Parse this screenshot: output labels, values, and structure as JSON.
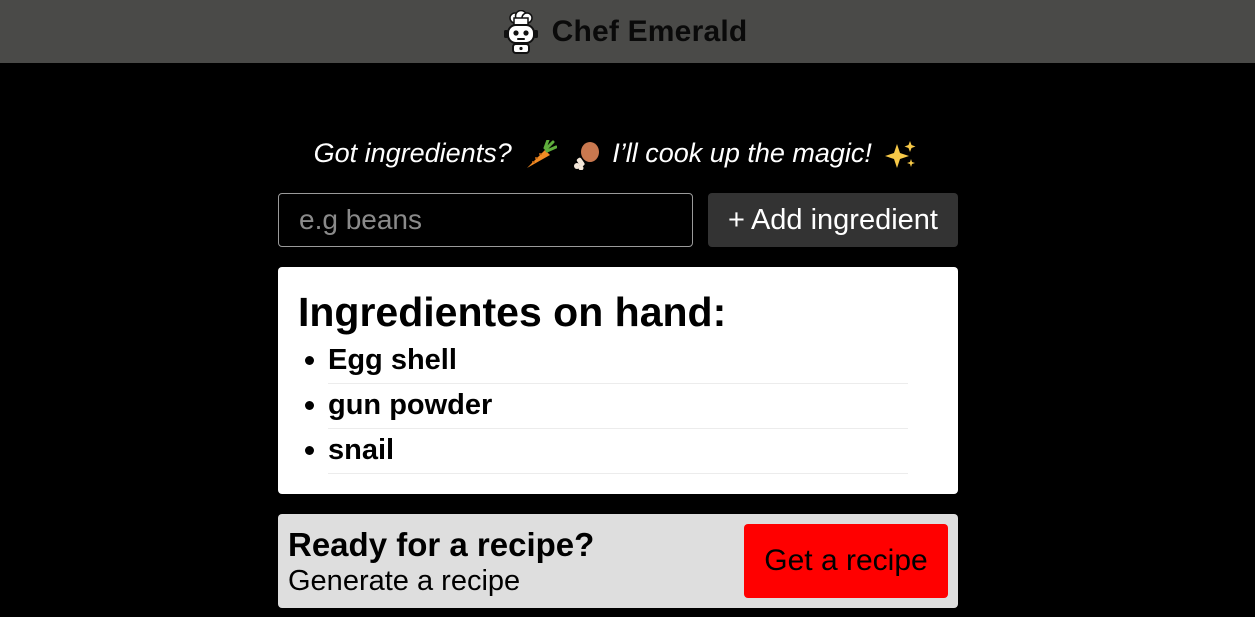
{
  "header": {
    "title": "Chef Emerald",
    "icon": "chef-robot-icon"
  },
  "tagline": {
    "text_start": "Got ingredients?",
    "text_end": "I’ll cook up the magic!",
    "icons": [
      "carrot-icon",
      "drumstick-icon",
      "sparkles-icon"
    ]
  },
  "form": {
    "placeholder": "e.g beans",
    "value": "",
    "add_label": "Add ingredient",
    "add_prefix": "+"
  },
  "ingredients": {
    "heading": "Ingredientes on hand:",
    "items": [
      "Egg shell",
      "gun powder",
      "snail"
    ]
  },
  "recipe": {
    "heading": "Ready for a recipe?",
    "subtext": "Generate a recipe",
    "button_label": "Get a recipe"
  },
  "colors": {
    "header_bg": "#4a4a48",
    "page_bg": "#000000",
    "add_button_bg": "#333333",
    "recipe_card_bg": "#dedede",
    "recipe_button_bg": "#ff0000"
  }
}
